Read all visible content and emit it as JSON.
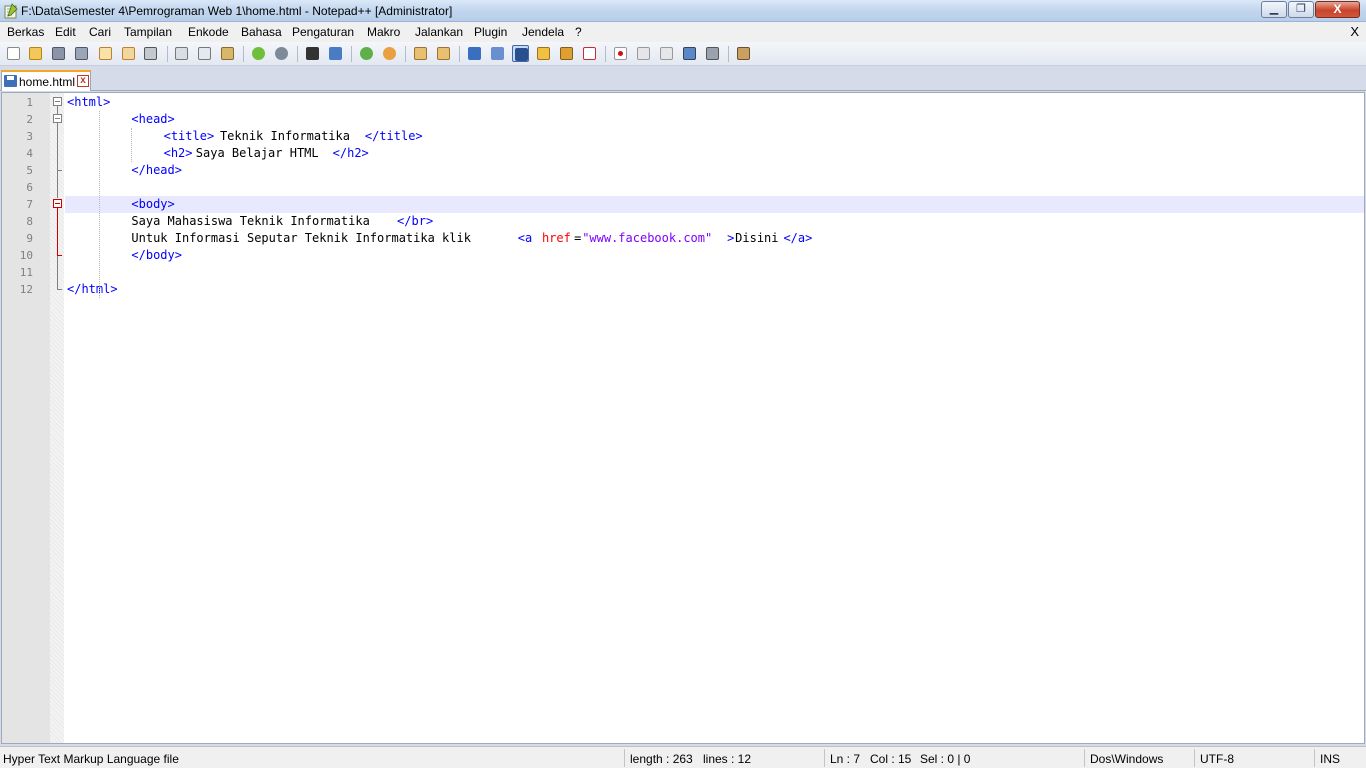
{
  "window": {
    "title": "F:\\Data\\Semester 4\\Pemrograman Web 1\\home.html - Notepad++ [Administrator]",
    "minimize_glyph": "▁",
    "maximize_glyph": "❐",
    "close_glyph": "X"
  },
  "menu": {
    "items": [
      "Berkas",
      "Edit",
      "Cari",
      "Tampilan",
      "Enkode",
      "Bahasa",
      "Pengaturan",
      "Makro",
      "Jalankan",
      "Plugin",
      "Jendela",
      "?"
    ],
    "close_label": "X"
  },
  "toolbar": {
    "icons": [
      "new-file-icon",
      "open-file-icon",
      "save-icon",
      "save-all-icon",
      "close-icon",
      "close-all-icon",
      "print-icon",
      "cut-icon",
      "copy-icon",
      "paste-icon",
      "undo-icon",
      "redo-icon",
      "find-icon",
      "replace-icon",
      "zoom-in-icon",
      "zoom-out-icon",
      "sync-vertical-icon",
      "sync-horizontal-icon",
      "word-wrap-icon",
      "show-all-chars-icon",
      "indent-guide-icon",
      "udl-icon",
      "doc-map-icon",
      "function-list-icon",
      "record-macro-icon",
      "stop-macro-icon",
      "play-macro-icon",
      "run-macro-multiple-icon",
      "save-macro-icon",
      "launch-browser-icon"
    ]
  },
  "tabs": [
    {
      "label": "home.html",
      "close_glyph": "x"
    }
  ],
  "editor": {
    "current_line": 7,
    "lines": [
      {
        "num": "1",
        "segments": [
          {
            "t": "<html>",
            "c": "tag"
          }
        ]
      },
      {
        "num": "2",
        "segments": [
          {
            "t": "<head>",
            "c": "tag"
          }
        ]
      },
      {
        "num": "3",
        "segments": [
          {
            "t": "<title>",
            "c": "tag"
          },
          {
            "t": "Teknik Informatika",
            "c": "text"
          },
          {
            "t": "</title>",
            "c": "tag"
          }
        ]
      },
      {
        "num": "4",
        "segments": [
          {
            "t": "<h2>",
            "c": "tag"
          },
          {
            "t": "Saya Belajar HTML",
            "c": "text"
          },
          {
            "t": "</h2>",
            "c": "tag"
          }
        ]
      },
      {
        "num": "5",
        "segments": [
          {
            "t": "</head>",
            "c": "tag"
          }
        ]
      },
      {
        "num": "6",
        "segments": []
      },
      {
        "num": "7",
        "segments": [
          {
            "t": "<body>",
            "c": "tag"
          }
        ]
      },
      {
        "num": "8",
        "segments": [
          {
            "t": "Saya Mahasiswa Teknik Informatika",
            "c": "text"
          },
          {
            "t": "</br>",
            "c": "tag"
          }
        ]
      },
      {
        "num": "9",
        "segments": [
          {
            "t": "Untuk Informasi Seputar Teknik Informatika klik ",
            "c": "text"
          },
          {
            "t": "<a ",
            "c": "tag"
          },
          {
            "t": "href",
            "c": "attr"
          },
          {
            "t": "=",
            "c": "eq"
          },
          {
            "t": "\"www.facebook.com\"",
            "c": "str"
          },
          {
            "t": ">",
            "c": "tag"
          },
          {
            "t": "Disini",
            "c": "text"
          },
          {
            "t": "</a>",
            "c": "tag"
          }
        ]
      },
      {
        "num": "10",
        "segments": [
          {
            "t": "</body>",
            "c": "tag"
          }
        ]
      },
      {
        "num": "11",
        "segments": []
      },
      {
        "num": "12",
        "segments": [
          {
            "t": "</html>",
            "c": "tag"
          }
        ]
      }
    ]
  },
  "status": {
    "file_type": "Hyper Text Markup Language file",
    "length": "length : 263",
    "lines": "lines : 12",
    "ln": "Ln : 7",
    "col": "Col : 15",
    "sel": "Sel : 0 | 0",
    "eol": "Dos\\Windows",
    "encoding": "UTF-8",
    "mode": "INS"
  }
}
